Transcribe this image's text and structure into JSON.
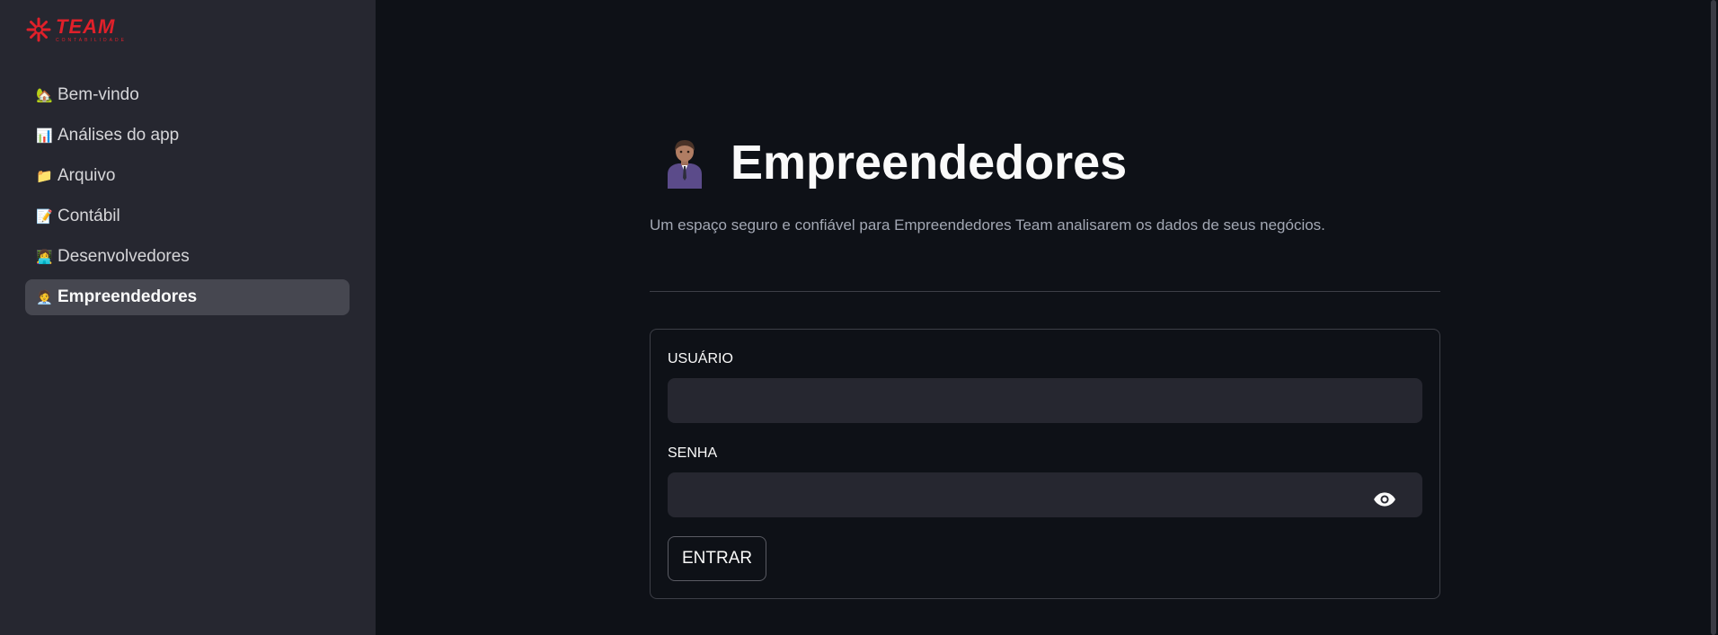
{
  "brand": {
    "name": "TEAM",
    "tagline": "CONTABILIDADE",
    "color": "#e0202a"
  },
  "sidebar": {
    "items": [
      {
        "icon": "house-icon",
        "glyph": "🏡",
        "label": "Bem-vindo",
        "active": false
      },
      {
        "icon": "bar-chart-icon",
        "glyph": "📊",
        "label": "Análises do app",
        "active": false
      },
      {
        "icon": "folder-icon",
        "glyph": "📁",
        "label": "Arquivo",
        "active": false
      },
      {
        "icon": "document-icon",
        "glyph": "📝",
        "label": "Contábil",
        "active": false
      },
      {
        "icon": "technologist-icon",
        "glyph": "👩‍💻",
        "label": "Desenvolvedores",
        "active": false
      },
      {
        "icon": "businessperson-icon",
        "glyph": "🧑‍💼",
        "label": "Empreendedores",
        "active": true
      }
    ]
  },
  "main": {
    "title": "Empreendedores",
    "subtitle": "Um espaço seguro e confiável para Empreendedores Team analisarem os dados de seus negócios.",
    "form": {
      "user_label": "USUÁRIO",
      "user_value": "",
      "password_label": "SENHA",
      "password_value": "",
      "submit_label": "ENTRAR"
    }
  },
  "colors": {
    "background": "#0e1117",
    "sidebar": "#262730",
    "active_item": "#464750",
    "input": "#262730"
  }
}
